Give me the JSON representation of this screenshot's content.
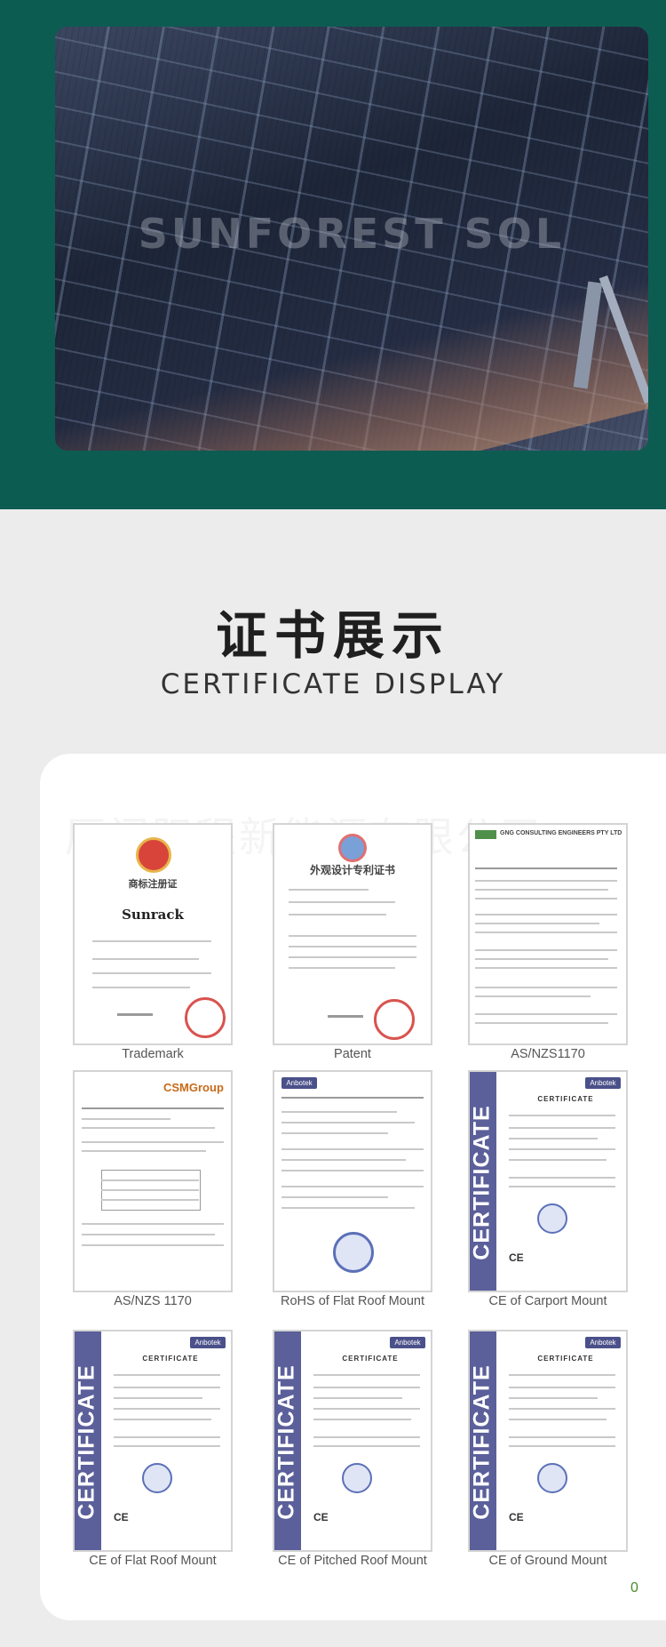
{
  "hero": {
    "watermark": "SUNFOREST SOL"
  },
  "section": {
    "title_cn": "证书展示",
    "title_en": "CERTIFICATE DISPLAY"
  },
  "card": {
    "watermark": "厦门阳程新能源有限公司"
  },
  "certificates": [
    {
      "caption": "Trademark",
      "doc_title": "商标注册证",
      "brand": "Sunrack",
      "style": "trademark"
    },
    {
      "caption": "Patent",
      "doc_title": "外观设计专利证书",
      "style": "patent"
    },
    {
      "caption": "AS/NZS1170",
      "doc_title": "GNG CONSULTING ENGINEERS PTY LTD",
      "style": "report"
    },
    {
      "caption": "AS/NZS 1170",
      "doc_title": "CSMGroup",
      "style": "report2"
    },
    {
      "caption": "RoHS of Flat Roof Mount",
      "doc_title": "Anbotek",
      "style": "rohs"
    },
    {
      "caption": "CE of Carport Mount",
      "doc_title": "CERTIFICATE",
      "style": "ce"
    },
    {
      "caption": "CE of Flat Roof Mount",
      "doc_title": "CERTIFICATE",
      "style": "ce"
    },
    {
      "caption": "CE of Pitched Roof Mount",
      "doc_title": "CERTIFICATE",
      "style": "ce"
    },
    {
      "caption": "CE of Ground Mount",
      "doc_title": "CERTIFICATE",
      "style": "ce"
    }
  ],
  "ce": {
    "vertical_text": "CERTIFICATE",
    "logo": "Anbotek",
    "mark": "CE"
  },
  "page_number": "0"
}
